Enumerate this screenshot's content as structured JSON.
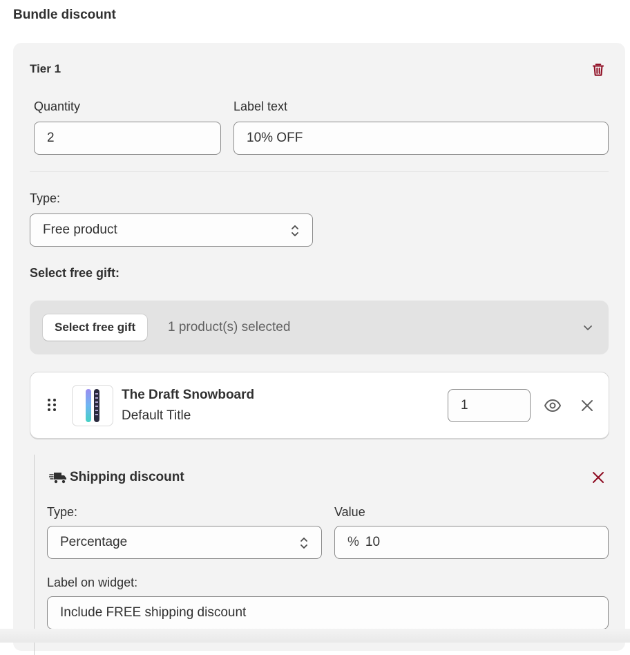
{
  "page": {
    "title": "Bundle discount"
  },
  "tier": {
    "title": "Tier 1",
    "quantity_label": "Quantity",
    "quantity_value": "2",
    "label_text_label": "Label text",
    "label_text_value": "10% OFF",
    "type_label": "Type:",
    "type_value": "Free product",
    "select_gift_label": "Select free gift:",
    "select_gift_button": "Select free gift",
    "selected_count": "1 product(s) selected"
  },
  "product": {
    "name": "The Draft Snowboard",
    "variant": "Default Title",
    "quantity": "1"
  },
  "shipping": {
    "title": "Shipping discount",
    "type_label": "Type:",
    "type_value": "Percentage",
    "value_label": "Value",
    "value_prefix": "%",
    "value": "10",
    "widget_label": "Label on widget:",
    "widget_value": "Include FREE shipping discount"
  },
  "colors": {
    "danger": "#8e0b21",
    "border": "#8a8a8a",
    "card_bg": "#f3f3f3"
  }
}
